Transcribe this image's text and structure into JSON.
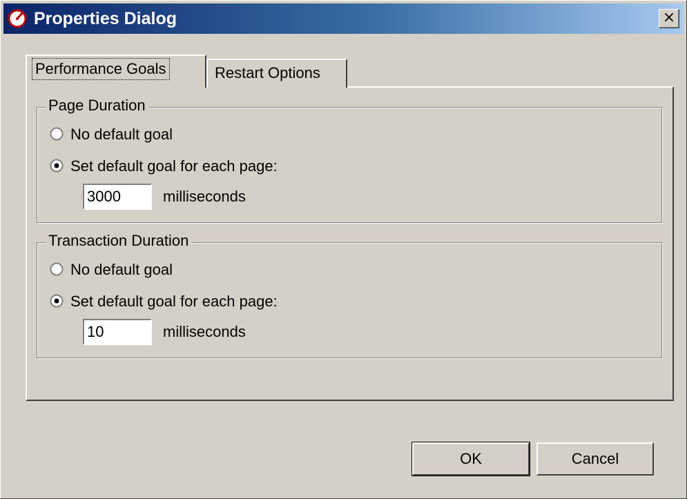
{
  "window": {
    "title": "Properties Dialog",
    "close_label": "×",
    "title_icon": "speedometer-icon",
    "titlebar_color": "#0a246a"
  },
  "tabs": [
    {
      "label": "Performance Goals",
      "active": true
    },
    {
      "label": "Restart Options",
      "active": false
    }
  ],
  "page_duration": {
    "legend": "Page Duration",
    "option_no_goal": "No default goal",
    "option_set_goal": "Set default goal for each page:",
    "selected": "set_goal",
    "value": "3000",
    "units": "milliseconds"
  },
  "transaction_duration": {
    "legend": "Transaction Duration",
    "option_no_goal": "No default goal",
    "option_set_goal": "Set default goal for each page:",
    "selected": "set_goal",
    "value": "10",
    "units": "milliseconds"
  },
  "buttons": {
    "ok": "OK",
    "cancel": "Cancel"
  }
}
